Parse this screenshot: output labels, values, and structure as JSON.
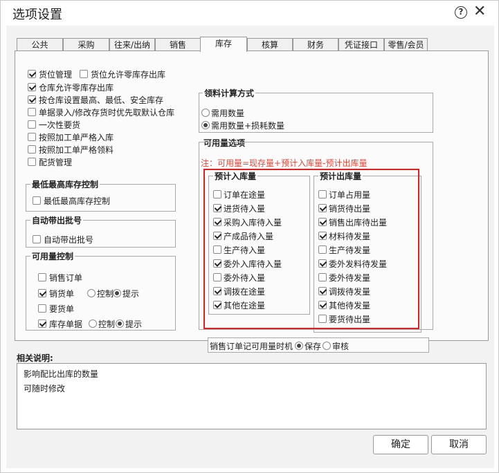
{
  "window": {
    "title": "选项设置",
    "help_icon": "?",
    "close_icon": "✕"
  },
  "tabs": [
    "公共",
    "采购",
    "往来/出纳",
    "销售",
    "库存",
    "核算",
    "财务",
    "凭证接口",
    "零售/会员"
  ],
  "active_tab": "库存",
  "left_options": [
    {
      "label": "货位管理",
      "checked": true
    },
    {
      "label": "货位允许零库存出库",
      "checked": false
    },
    {
      "label": "仓库允许零库存出库",
      "checked": true
    },
    {
      "label": "按仓库设置最高、最低、安全库存",
      "checked": true
    },
    {
      "label": "单据录入/修改存货时优先取默认仓库",
      "checked": false
    },
    {
      "label": "一次性要货",
      "checked": false
    },
    {
      "label": "按照加工单严格入库",
      "checked": false
    },
    {
      "label": "按照加工单严格领料",
      "checked": false
    },
    {
      "label": "配货管理",
      "checked": false
    }
  ],
  "stock_limit": {
    "title": "最低最高库存控制",
    "option": {
      "label": "最低最高库存控制",
      "checked": false
    }
  },
  "auto_batch": {
    "title": "自动带出批号",
    "option": {
      "label": "自动带出批号",
      "checked": false
    }
  },
  "available_control": {
    "title": "可用量控制",
    "items": [
      {
        "label": "销售订单",
        "checked": false
      },
      {
        "label": "销货单",
        "checked": true,
        "radios": [
          "控制",
          "提示"
        ],
        "selected": "提示"
      },
      {
        "label": "要货单",
        "checked": false
      },
      {
        "label": "库存单据",
        "checked": true,
        "radios": [
          "控制",
          "提示"
        ],
        "selected": "提示"
      }
    ]
  },
  "material_calc": {
    "title": "领料计算方式",
    "options": [
      "需用数量",
      "需用数量+损耗数量"
    ],
    "selected": "需用数量+损耗数量"
  },
  "available_options": {
    "title": "可用量选项",
    "note": "注：可用量=现存量+预计入库量-预计出库量",
    "inbound": {
      "title": "预计入库量",
      "items": [
        {
          "label": "订单在途量",
          "checked": false
        },
        {
          "label": "进货待入量",
          "checked": true
        },
        {
          "label": "采购入库待入量",
          "checked": true
        },
        {
          "label": "产成品待入量",
          "checked": true
        },
        {
          "label": "生产待入量",
          "checked": false
        },
        {
          "label": "委外入库待入量",
          "checked": true
        },
        {
          "label": "委外待入量",
          "checked": false
        },
        {
          "label": "调拨在途量",
          "checked": true
        },
        {
          "label": "其他在途量",
          "checked": true
        }
      ]
    },
    "outbound": {
      "title": "预计出库量",
      "items": [
        {
          "label": "订单占用量",
          "checked": false
        },
        {
          "label": "销货待出量",
          "checked": true
        },
        {
          "label": "销售出库待出量",
          "checked": true
        },
        {
          "label": "材料待发量",
          "checked": true
        },
        {
          "label": "生产待发量",
          "checked": false
        },
        {
          "label": "委外发料待发量",
          "checked": true
        },
        {
          "label": "委外待发量",
          "checked": false
        },
        {
          "label": "调拨待发量",
          "checked": true
        },
        {
          "label": "其他待发量",
          "checked": true
        },
        {
          "label": "要货待出量",
          "checked": false
        }
      ]
    },
    "sales_order_timing": {
      "label": "销售订单记可用量时机",
      "options": [
        "保存",
        "审核"
      ],
      "selected": "保存"
    }
  },
  "description": {
    "title": "相关说明:",
    "lines": [
      "影响配比出库的数量",
      "可随时修改"
    ]
  },
  "buttons": {
    "ok": "确定",
    "cancel": "取消"
  }
}
